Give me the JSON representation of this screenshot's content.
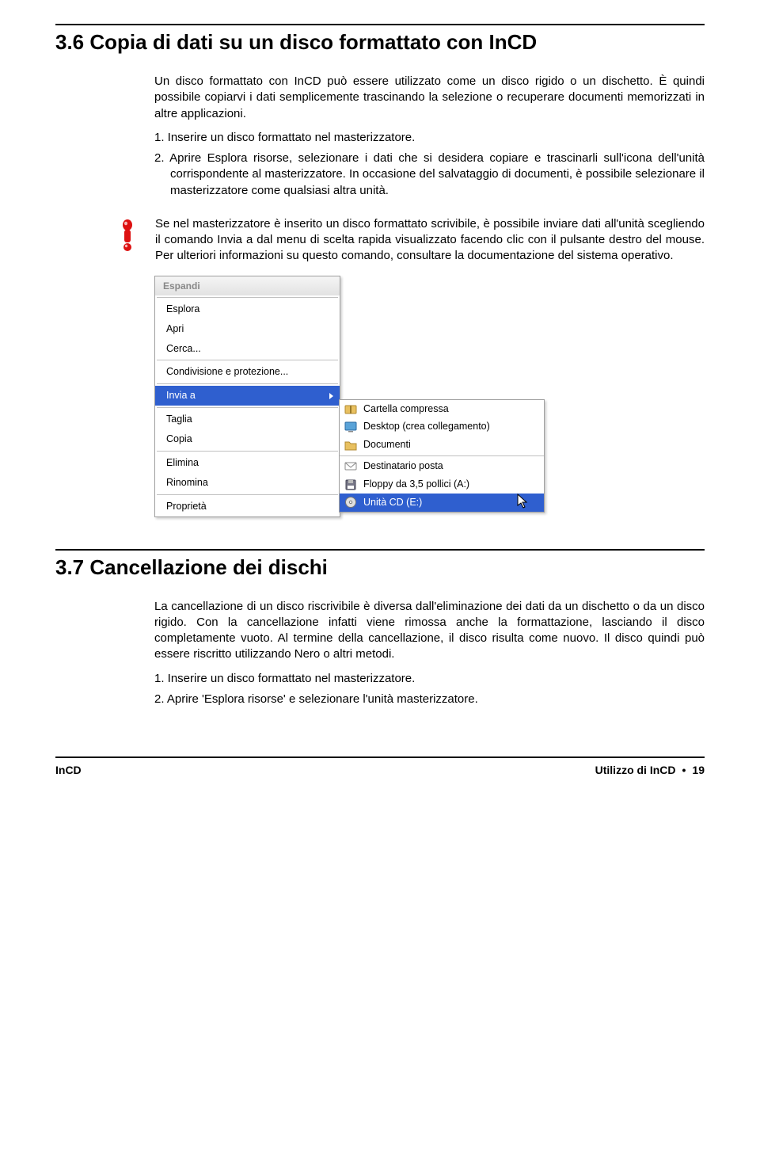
{
  "section36": {
    "heading": "3.6  Copia di dati su un disco formattato con InCD",
    "p1": "Un disco formattato con InCD può essere utilizzato come un disco rigido o un dischetto. È quindi possibile copiarvi i dati semplicemente trascinando la selezione o recuperare documenti memorizzati in altre applicazioni.",
    "step1": "1.  Inserire un disco formattato nel masterizzatore.",
    "step2": "2.  Aprire Esplora risorse, selezionare i dati che si desidera copiare e trascinarli sull'icona dell'unità corrispondente al masterizzatore. In occasione del salvataggio di documenti, è possibile selezionare il masterizzatore come qualsiasi altra unità.",
    "notice": "Se nel masterizzatore è inserito un disco formattato scrivibile, è possibile inviare dati all'unità scegliendo il comando Invia a dal menu di scelta rapida visualizzato facendo clic con il pulsante destro del mouse. Per ulteriori informazioni su questo comando, consultare la documentazione del sistema operativo."
  },
  "menu": {
    "header": "Espandi",
    "left": [
      "Esplora",
      "Apri",
      "Cerca...",
      "Condivisione e protezione...",
      "Invia a",
      "Taglia",
      "Copia",
      "Elimina",
      "Rinomina",
      "Proprietà"
    ],
    "right": [
      "Cartella compressa",
      "Desktop (crea collegamento)",
      "Documenti",
      "Destinatario posta",
      "Floppy da 3,5 pollici (A:)",
      "Unità CD (E:)"
    ]
  },
  "section37": {
    "heading": "3.7  Cancellazione dei dischi",
    "p1": "La cancellazione di un disco riscrivibile è diversa dall'eliminazione dei dati da un dischetto o da un disco rigido. Con la cancellazione infatti viene rimossa anche la formattazione, lasciando il disco completamente vuoto. Al termine della cancellazione, il disco risulta come nuovo. Il disco quindi può essere riscritto utilizzando Nero o altri metodi.",
    "step1": "1.  Inserire un disco formattato nel masterizzatore.",
    "step2": "2.  Aprire 'Esplora risorse' e selezionare l'unità masterizzatore."
  },
  "footer": {
    "left": "InCD",
    "right_label": "Utilizzo di InCD",
    "pagenum": "19"
  }
}
